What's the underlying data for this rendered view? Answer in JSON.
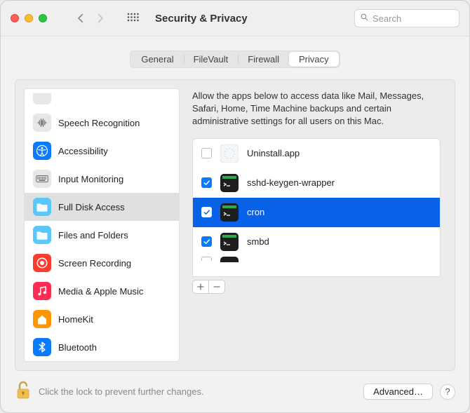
{
  "window": {
    "title": "Security & Privacy"
  },
  "search": {
    "placeholder": "Search"
  },
  "tabs": {
    "general": "General",
    "filevault": "FileVault",
    "firewall": "Firewall",
    "privacy": "Privacy",
    "selected": "privacy"
  },
  "sidebar": {
    "items": [
      {
        "id": "speech",
        "label": "Speech Recognition",
        "icon": "speech-icon",
        "bg": "#e7e7e7",
        "fg": "#6b6b6b"
      },
      {
        "id": "a11y",
        "label": "Accessibility",
        "icon": "a11y-icon",
        "bg": "#0a7aff",
        "fg": "#ffffff"
      },
      {
        "id": "input",
        "label": "Input Monitoring",
        "icon": "keyboard-icon",
        "bg": "#e7e7e7",
        "fg": "#6b6b6b"
      },
      {
        "id": "fulldisk",
        "label": "Full Disk Access",
        "icon": "folder-icon",
        "bg": "#5ac8fa",
        "fg": "#ffffff",
        "selected": true
      },
      {
        "id": "files",
        "label": "Files and Folders",
        "icon": "folder-icon",
        "bg": "#5ac8fa",
        "fg": "#ffffff"
      },
      {
        "id": "screenrec",
        "label": "Screen Recording",
        "icon": "record-icon",
        "bg": "#ff3b30",
        "fg": "#ffffff"
      },
      {
        "id": "media",
        "label": "Media & Apple Music",
        "icon": "music-icon",
        "bg": "#ff2d55",
        "fg": "#ffffff"
      },
      {
        "id": "homekit",
        "label": "HomeKit",
        "icon": "home-icon",
        "bg": "#ff9500",
        "fg": "#ffffff"
      },
      {
        "id": "bluetooth",
        "label": "Bluetooth",
        "icon": "bt-icon",
        "bg": "#0a7aff",
        "fg": "#ffffff"
      }
    ]
  },
  "detail": {
    "description": "Allow the apps below to access data like Mail, Messages, Safari, Home, Time Machine backups and certain administrative settings for all users on this Mac.",
    "apps": [
      {
        "name": "Uninstall.app",
        "checked": false,
        "icon": "generic",
        "selected": false
      },
      {
        "name": "sshd-keygen-wrapper",
        "checked": true,
        "icon": "term",
        "selected": false
      },
      {
        "name": "cron",
        "checked": true,
        "icon": "term",
        "selected": true
      },
      {
        "name": "smbd",
        "checked": true,
        "icon": "term",
        "selected": false
      }
    ]
  },
  "footer": {
    "lock_text": "Click the lock to prevent further changes.",
    "advanced_label": "Advanced…",
    "help_label": "?"
  }
}
